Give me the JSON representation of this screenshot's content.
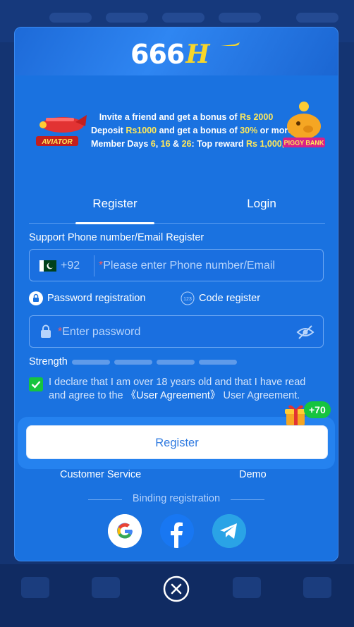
{
  "brand": {
    "logo_number": "666",
    "logo_letter": "H"
  },
  "promo": {
    "line1_a": "Invite a friend and get a bonus of ",
    "line1_b": "Rs 2000",
    "line2_a": "Deposit ",
    "line2_b": "Rs1000",
    "line2_c": " and get a bonus of ",
    "line2_d": "30%",
    "line2_e": " or more",
    "line3_a": "Member Days ",
    "line3_b": "6",
    "line3_c": ", ",
    "line3_d": "16",
    "line3_e": " & ",
    "line3_f": "26",
    "line3_g": ": Top reward ",
    "line3_h": "Rs 1,000,000",
    "left_badge": "AVIATOR",
    "right_badge": "PIGGY BANK"
  },
  "tabs": {
    "register": "Register",
    "login": "Login"
  },
  "form": {
    "section_label": "Support Phone number/Email Register",
    "country_code": "+92",
    "phone_placeholder": "Please enter Phone number/Email",
    "required_mark": "*",
    "mode_password": "Password registration",
    "mode_code": "Code register",
    "password_placeholder": "Enter password",
    "strength_label": "Strength",
    "agree_text_1": "I declare that I am over 18 years old and that I have read and agree to the ",
    "agree_link": "《User Agreement》",
    "agree_text_2": " User Agreement.",
    "bonus_badge": "+70",
    "register_button": "Register"
  },
  "links": {
    "customer_service": "Customer Service",
    "demo": "Demo"
  },
  "binding": {
    "label": "Binding registration"
  },
  "colors": {
    "modal_bg": "#1a72e0",
    "accent_yellow": "#ffe95a",
    "success_green": "#16c43f"
  }
}
